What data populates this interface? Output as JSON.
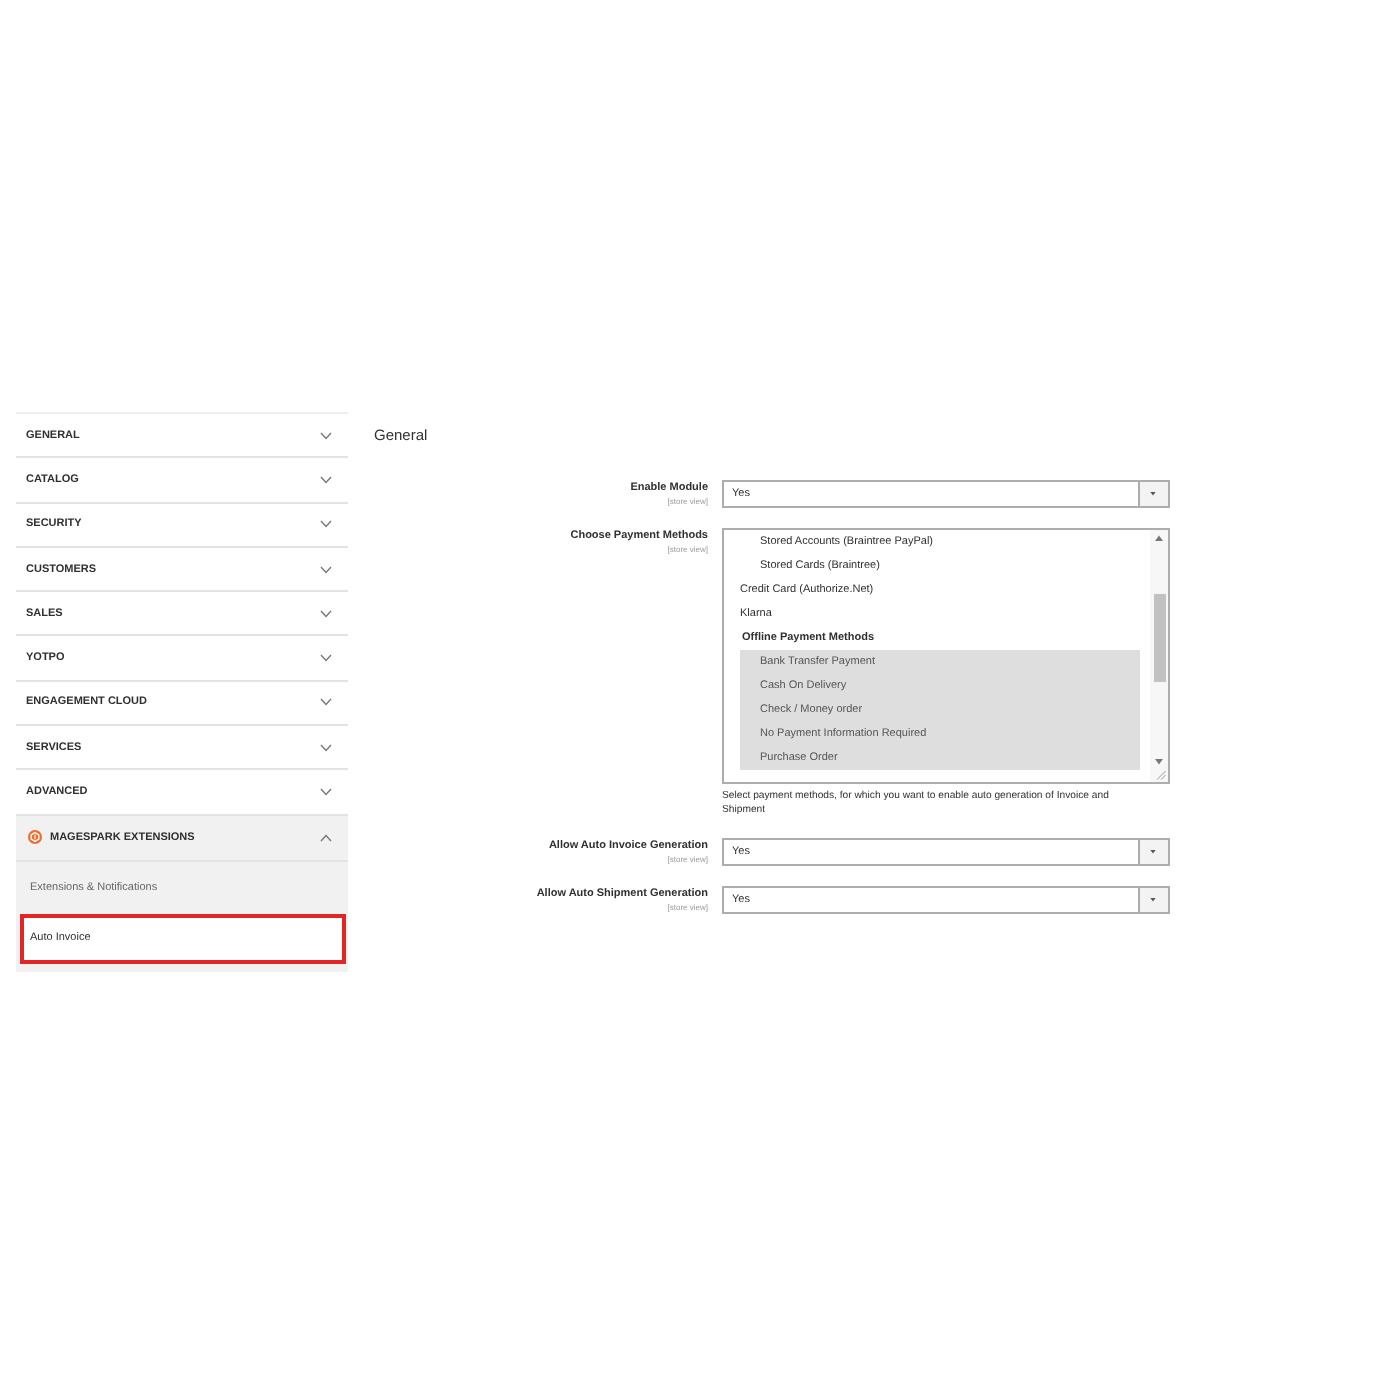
{
  "sidebar": {
    "sections": [
      {
        "label": "GENERAL",
        "kind": "core",
        "expanded": false
      },
      {
        "label": "CATALOG",
        "kind": "core",
        "expanded": false
      },
      {
        "label": "SECURITY",
        "kind": "core",
        "expanded": false
      },
      {
        "label": "CUSTOMERS",
        "kind": "core",
        "expanded": false
      },
      {
        "label": "SALES",
        "kind": "core",
        "expanded": false
      },
      {
        "label": "YOTPO",
        "kind": "core",
        "expanded": false
      },
      {
        "label": "ENGAGEMENT CLOUD",
        "kind": "core",
        "expanded": false
      },
      {
        "label": "SERVICES",
        "kind": "core",
        "expanded": false
      },
      {
        "label": "ADVANCED",
        "kind": "core",
        "expanded": false
      },
      {
        "label": "MAGESPARK EXTENSIONS",
        "kind": "extension",
        "expanded": true,
        "children": [
          {
            "label": "Extensions & Notifications",
            "selected": false
          },
          {
            "label": "Auto Invoice",
            "selected": true
          }
        ]
      }
    ]
  },
  "main": {
    "section_title": "General",
    "fields": [
      {
        "kind": "select",
        "label": "Enable Module",
        "scope": "[store view]",
        "value": "Yes"
      },
      {
        "kind": "multiselect",
        "label": "Choose Payment Methods",
        "scope": "[store view]",
        "options": [
          {
            "kind": "group",
            "children": [
              {
                "kind": "option",
                "label": "Stored Accounts (Braintree PayPal)",
                "selected": false
              },
              {
                "kind": "option",
                "label": "Stored Cards (Braintree)",
                "selected": false
              }
            ]
          },
          {
            "kind": "option",
            "label": "Credit Card (Authorize.Net)",
            "selected": false
          },
          {
            "kind": "option",
            "label": "Klarna",
            "selected": false
          },
          {
            "kind": "group",
            "label": "Offline Payment Methods",
            "children": [
              {
                "kind": "option",
                "label": "Bank Transfer Payment",
                "selected": true
              },
              {
                "kind": "option",
                "label": "Cash On Delivery",
                "selected": true
              },
              {
                "kind": "option",
                "label": "Check / Money order",
                "selected": true
              },
              {
                "kind": "option",
                "label": "No Payment Information Required",
                "selected": true
              },
              {
                "kind": "option",
                "label": "Purchase Order",
                "selected": true
              }
            ]
          }
        ],
        "note": "Select payment methods, for which you want to enable auto generation of Invoice and Shipment"
      },
      {
        "kind": "select",
        "label": "Allow Auto Invoice Generation",
        "scope": "[store view]",
        "value": "Yes"
      },
      {
        "kind": "select",
        "label": "Allow Auto Shipment Generation",
        "scope": "[store view]",
        "value": "Yes"
      }
    ]
  }
}
